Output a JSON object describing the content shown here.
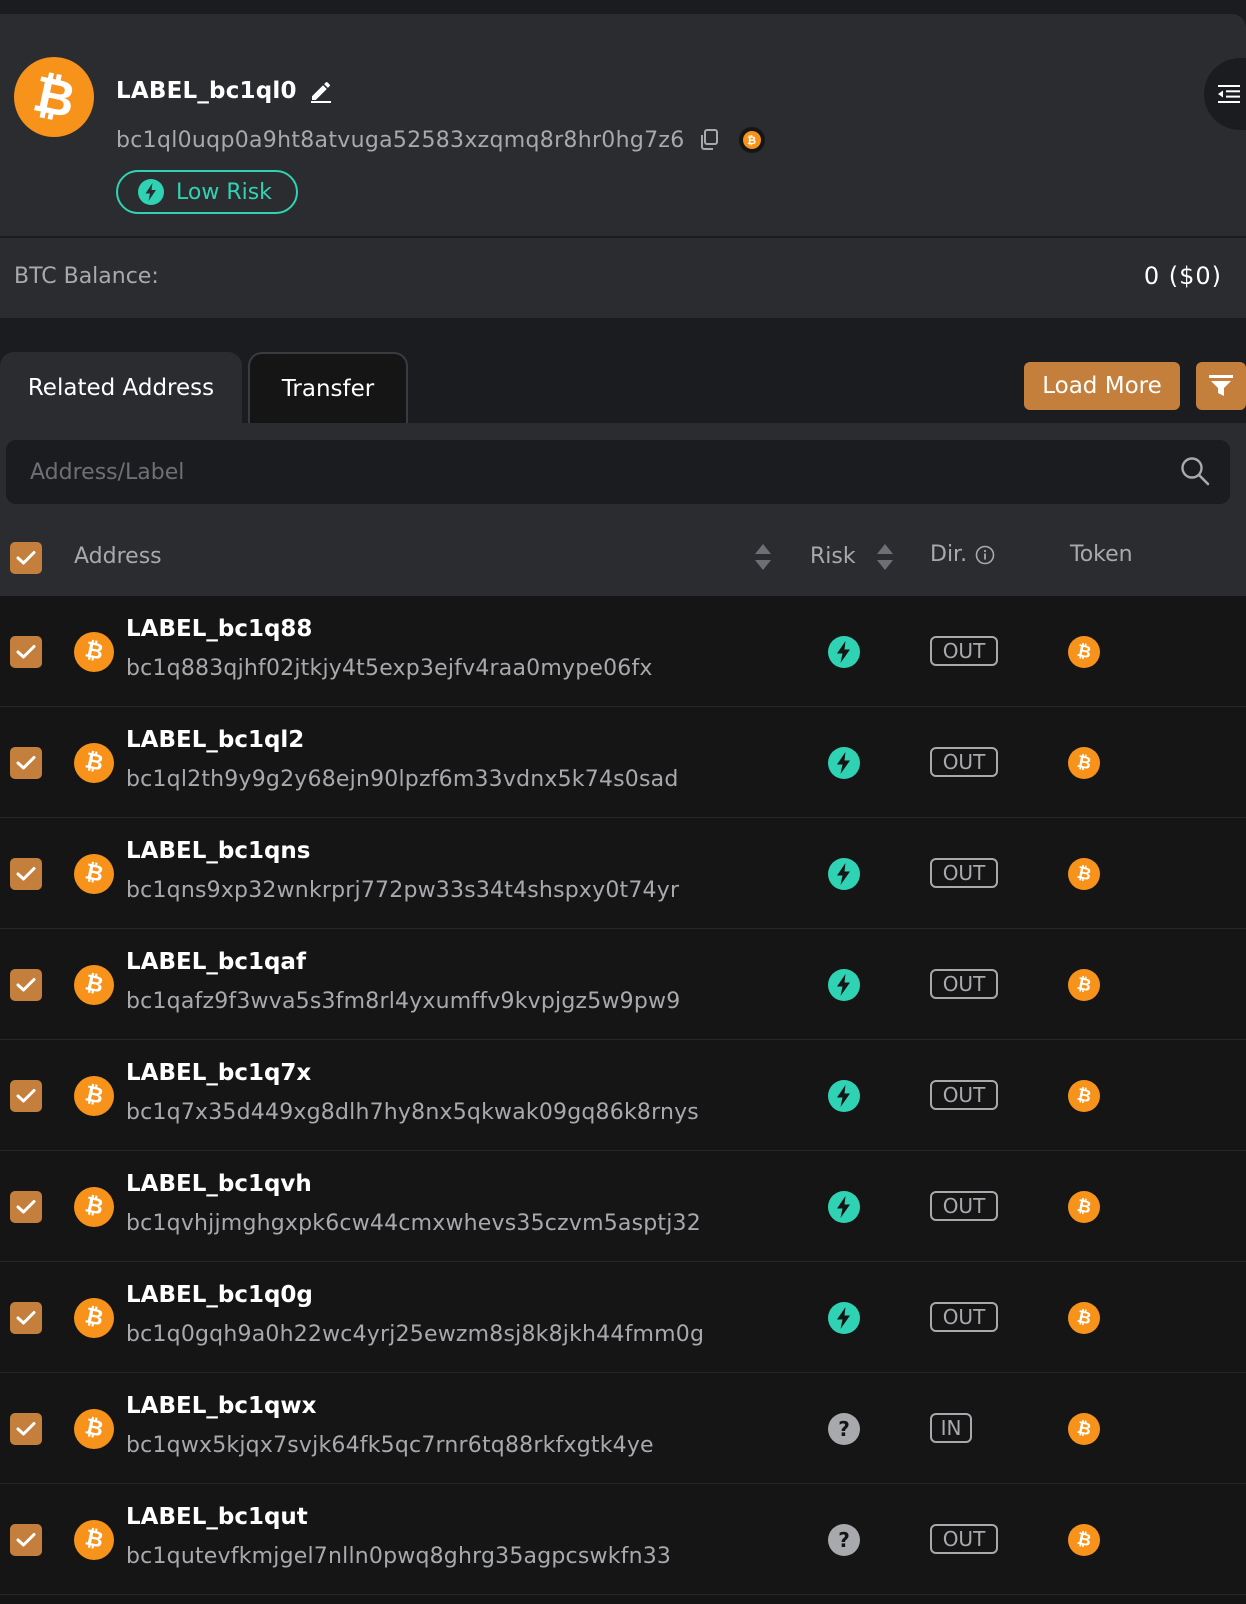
{
  "header": {
    "title": "LABEL_bc1ql0",
    "address": "bc1ql0uqp0a9ht8atvuga52583xzqmq8r8hr0hg7z6",
    "coin_symbol": "₿",
    "risk_label": "Low Risk"
  },
  "balance": {
    "label": "BTC Balance:",
    "value": "0 ($0)"
  },
  "tabs": [
    {
      "label": "Related Address"
    },
    {
      "label": "Transfer"
    }
  ],
  "toolbar": {
    "load_more_label": "Load More"
  },
  "search": {
    "placeholder": "Address/Label"
  },
  "table": {
    "columns": {
      "address": "Address",
      "risk": "Risk",
      "dir": "Dir.",
      "token": "Token"
    },
    "rows": [
      {
        "label": "LABEL_bc1q88",
        "address": "bc1q883qjhf02jtkjy4t5exp3ejfv4raa0mype06fx",
        "risk": "low",
        "dir": "OUT"
      },
      {
        "label": "LABEL_bc1ql2",
        "address": "bc1ql2th9y9g2y68ejn90lpzf6m33vdnx5k74s0sad",
        "risk": "low",
        "dir": "OUT"
      },
      {
        "label": "LABEL_bc1qns",
        "address": "bc1qns9xp32wnkrprj772pw33s34t4shspxy0t74yr",
        "risk": "low",
        "dir": "OUT"
      },
      {
        "label": "LABEL_bc1qaf",
        "address": "bc1qafz9f3wva5s3fm8rl4yxumffv9kvpjgz5w9pw9",
        "risk": "low",
        "dir": "OUT"
      },
      {
        "label": "LABEL_bc1q7x",
        "address": "bc1q7x35d449xg8dlh7hy8nx5qkwak09gq86k8rnys",
        "risk": "low",
        "dir": "OUT"
      },
      {
        "label": "LABEL_bc1qvh",
        "address": "bc1qvhjjmghgxpk6cw44cmxwhevs35czvm5asptj32",
        "risk": "low",
        "dir": "OUT"
      },
      {
        "label": "LABEL_bc1q0g",
        "address": "bc1q0gqh9a0h22wc4yrj25ewzm8sj8k8jkh44fmm0g",
        "risk": "low",
        "dir": "OUT"
      },
      {
        "label": "LABEL_bc1qwx",
        "address": "bc1qwx5kjqx7svjk64fk5qc7rnr6tq88rkfxgtk4ye",
        "risk": "unknown",
        "dir": "IN"
      },
      {
        "label": "LABEL_bc1qut",
        "address": "bc1qutevfkmjgel7nlln0pwq8ghrg35agpcswkfn33",
        "risk": "unknown",
        "dir": "OUT"
      }
    ]
  },
  "colors": {
    "accent": "#c57f3d",
    "bitcoin": "#f7931a",
    "low_risk": "#2fd3b4",
    "unknown_risk": "#a8a9ad",
    "panel": "#2b2c30",
    "background": "#151516"
  },
  "icons": {
    "edit": "pencil-icon",
    "copy": "copy-icon",
    "menu": "collapse-menu-icon",
    "filter": "filter-icon",
    "search": "search-icon",
    "low_risk": "bolt-icon",
    "unknown_risk": "question-icon"
  }
}
